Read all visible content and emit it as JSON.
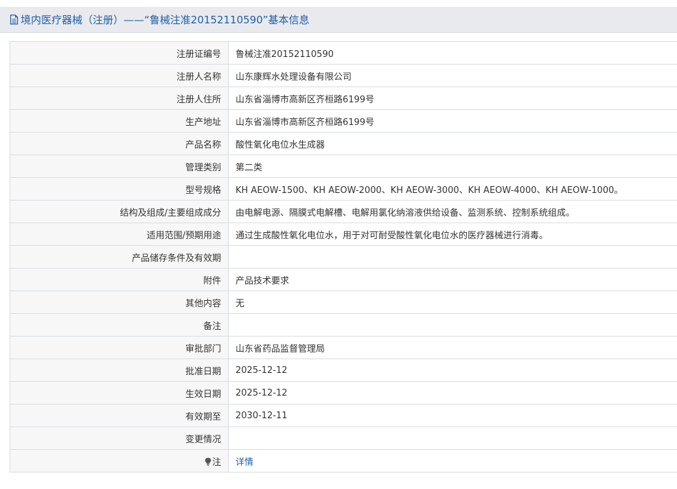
{
  "header": {
    "title": "境内医疗器械（注册）——“鲁械注准20152110590”基本信息",
    "icon": "document-icon"
  },
  "rows": [
    {
      "key": "注册证编号",
      "value": "鲁械注准20152110590"
    },
    {
      "key": "注册人名称",
      "value": "山东康辉水处理设备有限公司"
    },
    {
      "key": "注册人住所",
      "value": "山东省淄博市高新区齐桓路6199号"
    },
    {
      "key": "生产地址",
      "value": "山东省淄博市高新区齐桓路6199号"
    },
    {
      "key": "产品名称",
      "value": "酸性氧化电位水生成器"
    },
    {
      "key": "管理类别",
      "value": "第二类"
    },
    {
      "key": "型号规格",
      "value": "KH AEOW-1500、KH AEOW-2000、KH AEOW-3000、KH AEOW-4000、KH AEOW-1000。"
    },
    {
      "key": "结构及组成/主要组成成分",
      "value": "由电解电源、隔膜式电解槽、电解用氯化纳溶液供给设备、监测系统、控制系统组成。"
    },
    {
      "key": "适用范围/预期用途",
      "value": "通过生成酸性氧化电位水，用于对可耐受酸性氧化电位水的医疗器械进行消毒。"
    },
    {
      "key": "产品储存条件及有效期",
      "value": ""
    },
    {
      "key": "附件",
      "value": "产品技术要求"
    },
    {
      "key": "其他内容",
      "value": "无"
    },
    {
      "key": "备注",
      "value": ""
    },
    {
      "key": "审批部门",
      "value": "山东省药品监督管理局"
    },
    {
      "key": "批准日期",
      "value": "2025-12-12"
    },
    {
      "key": "生效日期",
      "value": "2025-12-12"
    },
    {
      "key": "有效期至",
      "value": "2030-12-11"
    },
    {
      "key": "变更情况",
      "value": ""
    }
  ],
  "note_row": {
    "key": "注",
    "icon": "lightbulb-icon",
    "link_label": "详情"
  },
  "colors": {
    "title": "#1f5fa8",
    "link": "#1f5fa8",
    "header_bg": "#e8eaed",
    "key_bg": "#f7f7f7",
    "border": "#d9dde2"
  }
}
